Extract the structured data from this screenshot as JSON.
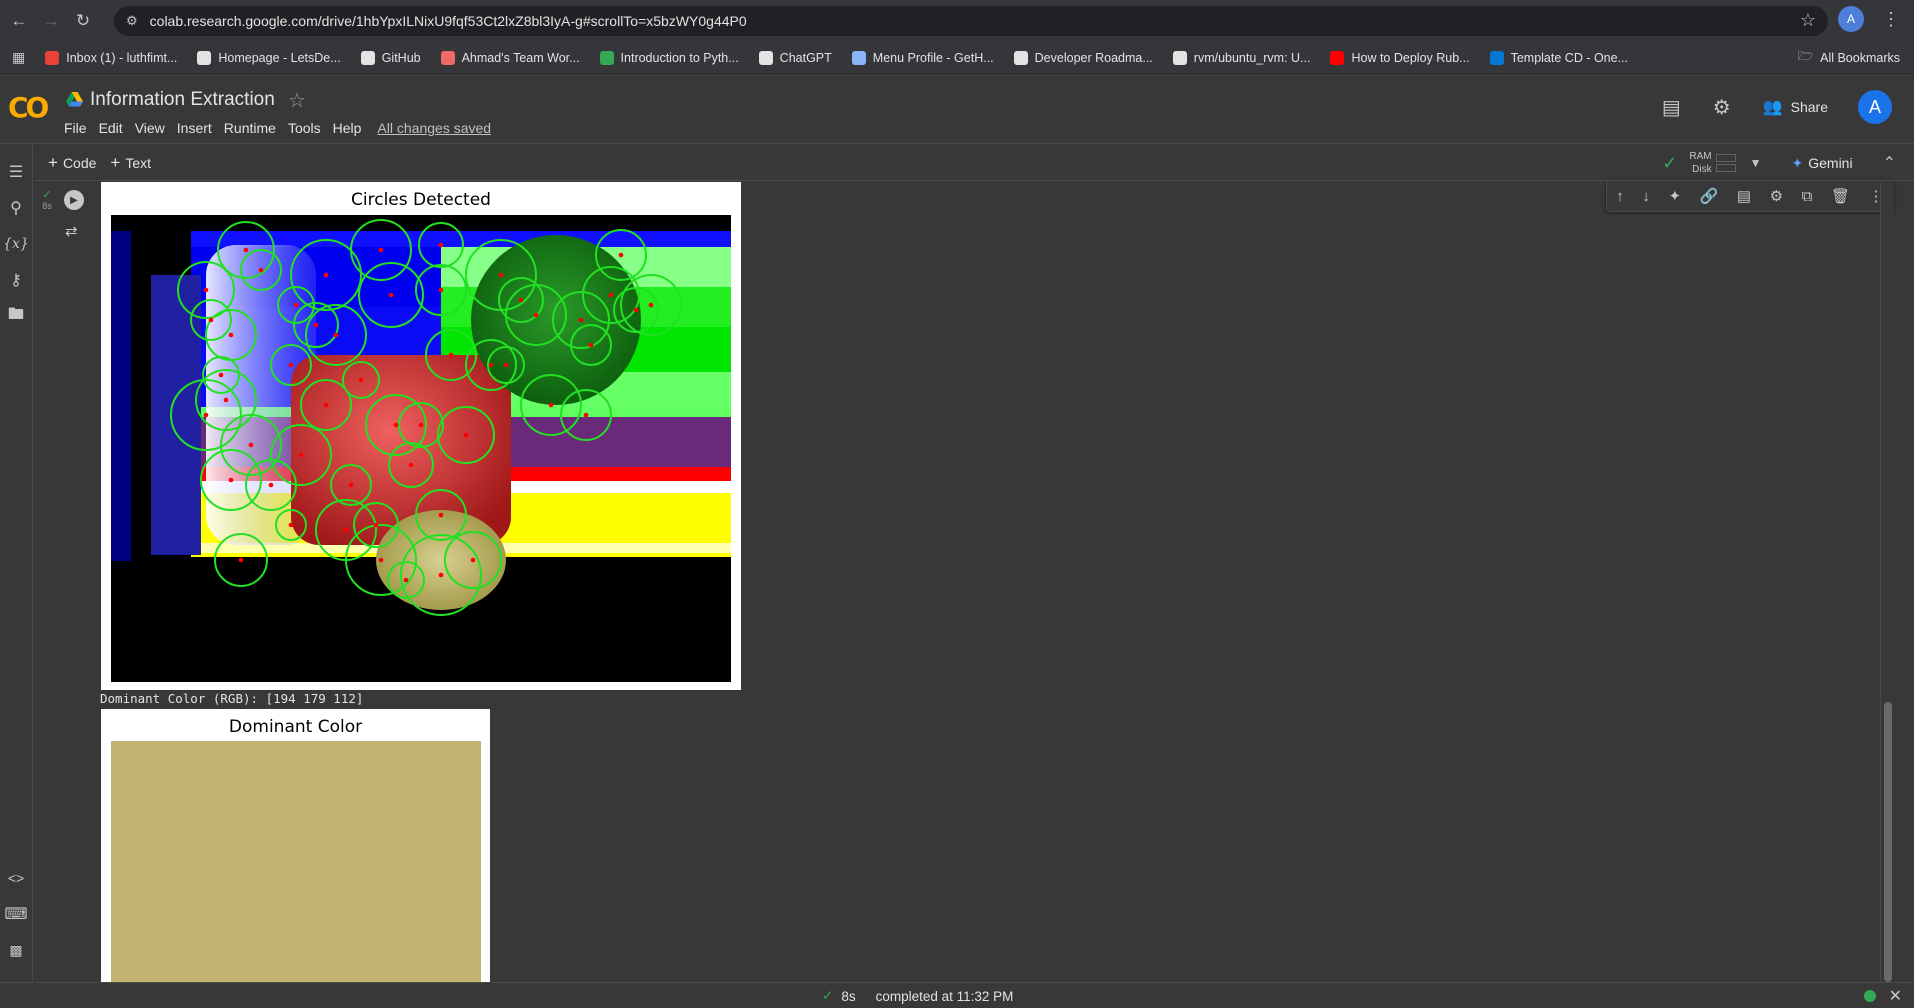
{
  "browser": {
    "url": "colab.research.google.com/drive/1hbYpxILNixU9fqf53Ct2lxZ8bl3IyA-g#scrollTo=x5bzWY0g44P0",
    "profile_initial": "A",
    "bookmarks": [
      {
        "label": "Inbox (1) - luthfimt...",
        "icon": "gmail-icon",
        "color": "#ea4335"
      },
      {
        "label": "Homepage - LetsDe...",
        "icon": "letsdeploy-icon",
        "color": "#e3e3e3"
      },
      {
        "label": "GitHub",
        "icon": "github-icon",
        "color": "#e3e3e3"
      },
      {
        "label": "Ahmad's Team Wor...",
        "icon": "asana-icon",
        "color": "#f06a6a"
      },
      {
        "label": "Introduction to Pyth...",
        "icon": "w-icon",
        "color": "#34a853"
      },
      {
        "label": "ChatGPT",
        "icon": "chatgpt-icon",
        "color": "#e3e3e3"
      },
      {
        "label": "Menu Profile - GetH...",
        "icon": "info-icon",
        "color": "#8ab4f8"
      },
      {
        "label": "Developer Roadma...",
        "icon": "roadmap-icon",
        "color": "#e3e3e3"
      },
      {
        "label": "rvm/ubuntu_rvm: U...",
        "icon": "github-icon",
        "color": "#e3e3e3"
      },
      {
        "label": "How to Deploy Rub...",
        "icon": "youtube-icon",
        "color": "#ff0000"
      },
      {
        "label": "Template CD - One...",
        "icon": "onedrive-icon",
        "color": "#0078d4"
      }
    ],
    "all_bookmarks": "All Bookmarks"
  },
  "colab": {
    "title": "Information Extraction",
    "menu": [
      "File",
      "Edit",
      "View",
      "Insert",
      "Runtime",
      "Tools",
      "Help"
    ],
    "saved_status": "All changes saved",
    "share_label": "Share",
    "avatar_initial": "A",
    "toolbar": {
      "add_code": "Code",
      "add_text": "Text",
      "ram_label": "RAM",
      "disk_label": "Disk",
      "gemini_label": "Gemini"
    },
    "run_time_short": "8s"
  },
  "output": {
    "figure1_title": "Circles Detected",
    "stdout_line": "Dominant Color (RGB): [194 179 112]",
    "figure2_title": "Dominant Color",
    "dominant_color_hex": "#c2b370"
  },
  "status": {
    "elapsed": "8s",
    "completed": "completed at 11:32 PM"
  },
  "colors": {
    "accent": "#f9ab00",
    "ok": "#34a853",
    "circle_stroke": "#22e022",
    "center_dot": "#ff0000"
  }
}
